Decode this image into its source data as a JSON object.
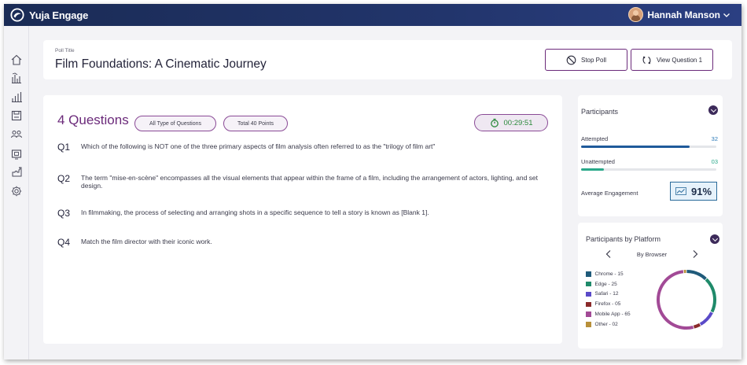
{
  "app": {
    "name": "Yuja Engage"
  },
  "user": {
    "name": "Hannah Manson"
  },
  "sidebar": {
    "icons": [
      "home-icon",
      "bar-chart-icon",
      "growth-chart-icon",
      "save-icon",
      "users-icon",
      "presentation-icon",
      "puzzle-icon",
      "settings-icon"
    ]
  },
  "poll": {
    "label": "Poll Title",
    "title": "Film Foundations: A Cinematic Journey",
    "stop_label": "Stop Poll",
    "view_label": "View Question 1"
  },
  "questions": {
    "count_label": "4 Questions",
    "type_pill": "All Type of Questions",
    "points_pill": "Total 40 Points",
    "timer": "00:29:51",
    "items": [
      {
        "num": "Q1",
        "text": "Which of the following is NOT one of the three primary aspects of film analysis often referred to as the \"trilogy of film art\""
      },
      {
        "num": "Q2",
        "text": "The term \"mise-en-scène\" encompasses all the visual elements that appear within the frame of a film, including the arrangement of actors, lighting, and set design."
      },
      {
        "num": "Q3",
        "text": "In filmmaking, the process of selecting and arranging shots in a specific sequence to tell a story is known as [Blank 1]."
      },
      {
        "num": "Q4",
        "text": "Match the film director with their iconic work."
      }
    ]
  },
  "participants": {
    "title": "Participants",
    "attempted_label": "Attempted",
    "attempted_value": "32",
    "attempted_fraction": 0.8,
    "unattempted_label": "Unattempted",
    "unattempted_value": "03",
    "unattempted_fraction": 0.17,
    "engagement_label": "Average Engagement",
    "engagement_value": "91%"
  },
  "platform": {
    "title": "Participants by Platform",
    "mode": "By Browser",
    "items": [
      {
        "label": "Chrome - 15",
        "value": 15,
        "color": "#1f5a7a"
      },
      {
        "label": "Edge - 25",
        "value": 25,
        "color": "#1f8a6a"
      },
      {
        "label": "Safari - 12",
        "value": 12,
        "color": "#5a4ac8"
      },
      {
        "label": "Firefox - 05",
        "value": 5,
        "color": "#8a2a2a"
      },
      {
        "label": "Mobile App - 65",
        "value": 65,
        "color": "#a24a96"
      },
      {
        "label": "Other - 02",
        "value": 2,
        "color": "#b8903a"
      }
    ]
  },
  "colors": {
    "topbar": "#1e2f60",
    "accent": "#6b2a7a",
    "attempted_bar": "#1f5a9a",
    "unattempted_bar": "#2aa88a",
    "timer_text": "#2c8a3c"
  }
}
